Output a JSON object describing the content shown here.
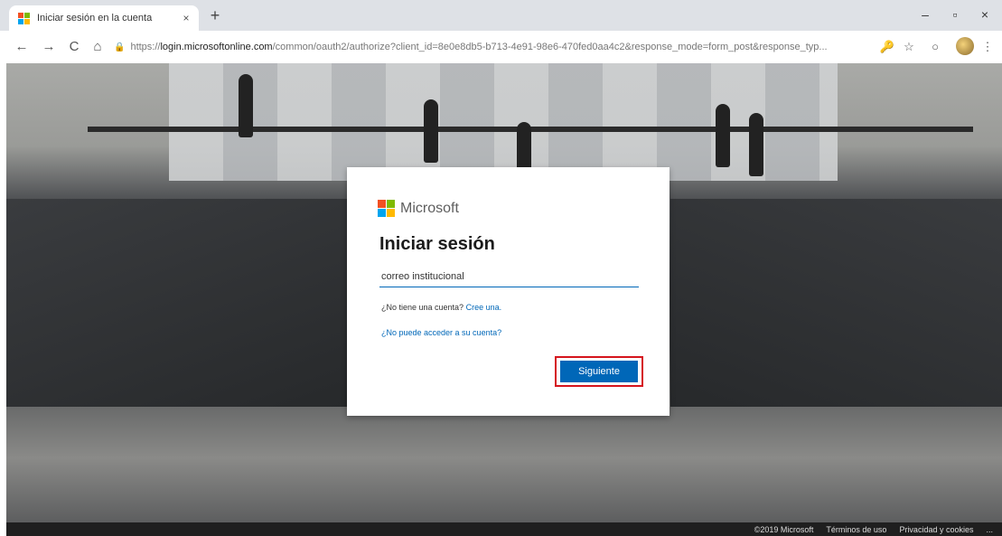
{
  "browser": {
    "tab": {
      "title": "Iniciar sesión en la cuenta",
      "close_glyph": "×"
    },
    "new_tab_glyph": "+",
    "window_controls": {
      "minimize": "–",
      "maximize": "▫",
      "close": "×"
    },
    "nav": {
      "back": "←",
      "forward": "→",
      "reload": "C",
      "home": "⌂"
    },
    "address": {
      "url_prefix": "https://",
      "url_host": "login.microsoftonline.com",
      "url_rest": "/common/oauth2/authorize?client_id=8e0e8db5-b713-4e91-98e6-470fed0aa4c2&response_mode=form_post&response_typ..."
    },
    "toolbar_icons": {
      "key": "🔑",
      "star": "☆",
      "circle": "○",
      "menu": "⋮"
    }
  },
  "login": {
    "brand": "Microsoft",
    "title": "Iniciar sesión",
    "email_value": "correo institucional",
    "no_account_text": "¿No tiene una cuenta?",
    "create_link": "Cree una.",
    "cant_access_link": "¿No puede acceder a su cuenta?",
    "next_button": "Siguiente",
    "highlight_color": "#d5141d",
    "accent_color": "#0067b8"
  },
  "footer": {
    "copyright": "©2019 Microsoft",
    "terms": "Términos de uso",
    "privacy": "Privacidad y cookies",
    "more": "..."
  }
}
